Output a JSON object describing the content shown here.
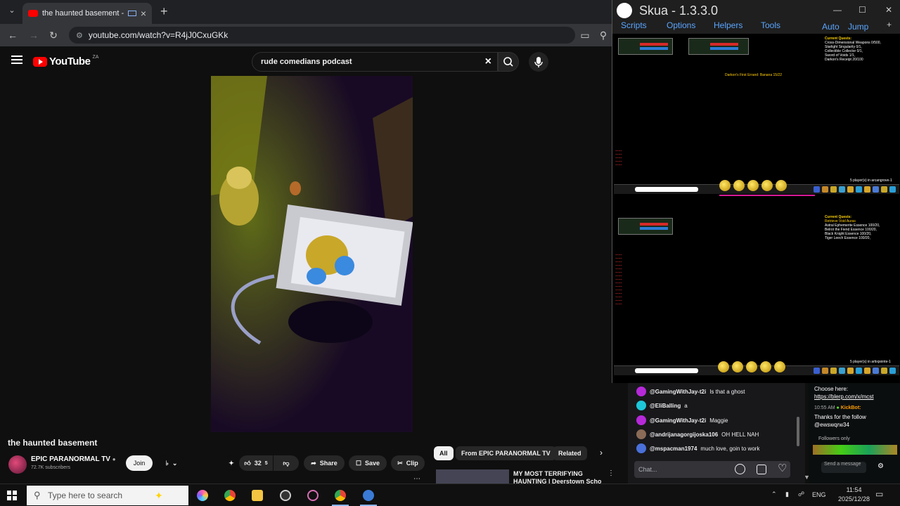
{
  "browser": {
    "tab_title": "the haunted basement - Yo",
    "url": "youtube.com/watch?v=R4jJ0CxuGKk",
    "new_tab_label": "+"
  },
  "youtube": {
    "logo_text": "YouTube",
    "country_code": "ZA",
    "search_query": "rude comedians podcast",
    "video_title": "the haunted basement",
    "channel_name": "EPIC PARANORMAL TV",
    "subscribers": "72.7K subscribers",
    "join_label": "Join",
    "like_count": "32",
    "like_badge": "5",
    "share_label": "Share",
    "save_label": "Save",
    "clip_label": "Clip",
    "chips": [
      "All",
      "From EPIC PARANORMAL TV",
      "Related"
    ],
    "related_title_1": "MY MOST TERRIFYING",
    "related_title_2": "HAUNTING | Deerstown School"
  },
  "skua": {
    "title": "Skua - 1.3.3.0",
    "menu": [
      "Scripts",
      "Options",
      "Helpers",
      "Tools"
    ],
    "menu_right": [
      "Auto",
      "Jump",
      "+"
    ],
    "top_quest_header": "Current Quests:",
    "top_quests": [
      "Cross-Dimensional Weapons 0/500,",
      "Starlight Singularity 0/1,",
      "Collectible Collector 0/1,",
      "Sword of Voids 1/1,",
      "Darkon's Receipt 20/100"
    ],
    "top_event": "Darkon's First Errand: Banana 15/22",
    "bottom_quest_header": "Current Quests:",
    "bottom_quest_sub": "Retrieve Void Auras",
    "bottom_quests": [
      "Astral Ephemerite Essence 100/20,",
      "Belrot the Fiend Essence 100/20,",
      "Black Knight Essence 100/20,",
      "Tiger Leech Essence 100/20,"
    ],
    "top_players": "5 player(s) in arcangrove-1",
    "bottom_players": "5 player(s) in artixpointe-1"
  },
  "twitch": {
    "messages": [
      {
        "user": "@GamingWithJay-t2i",
        "text": "Is that a ghost",
        "color": "#b629d9"
      },
      {
        "user": "@EliBalling",
        "text": "a",
        "color": "#1ec6d9"
      },
      {
        "user": "@GamingWithJay-t2i",
        "text": "Maggie",
        "color": "#b629d9"
      },
      {
        "user": "@andrijanagorgijoska106",
        "text": "OH HELL NAH",
        "color": "#8a6b58"
      },
      {
        "user": "@mspacman1974",
        "text": "much love, goin to work",
        "color": "#4a70d9"
      }
    ],
    "input_placeholder": "Chat..."
  },
  "kick": {
    "choose": "Choose here:",
    "link": "https://blerp.com/x/mcst",
    "time": "10:55 AM",
    "bot": "KickBot:",
    "thanks": "Thanks for the follow",
    "handle": "@ewswqrw34",
    "followers": "Followers only",
    "send": "Send a message"
  },
  "taskbar": {
    "search_placeholder": "Type here to search",
    "lang": "ENG",
    "time": "11:54",
    "date": "2025/12/28"
  }
}
